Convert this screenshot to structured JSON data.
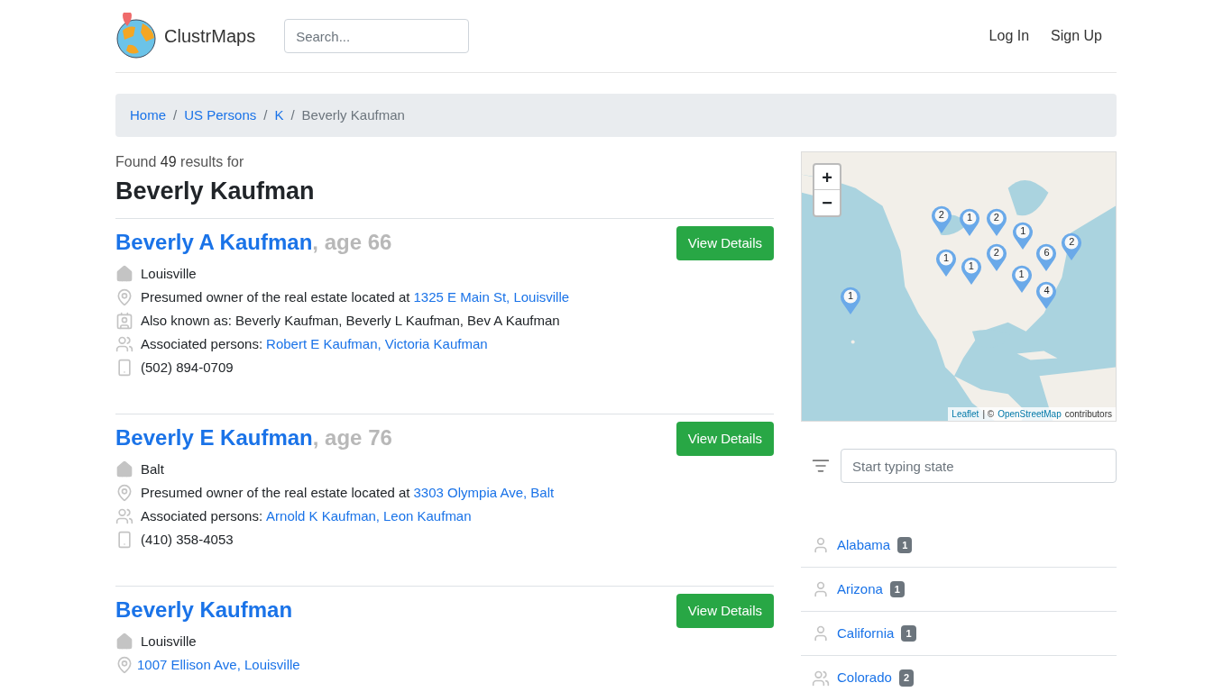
{
  "header": {
    "brand": "ClustrMaps",
    "search": {
      "placeholder": "Search..."
    },
    "nav": [
      "Log In",
      "Sign Up"
    ]
  },
  "breadcrumb": [
    {
      "label": "Home",
      "link": true
    },
    {
      "separator": "/",
      "label": "US Persons",
      "link": true
    },
    {
      "separator": "/",
      "label": "K",
      "link": true
    },
    {
      "separator": "/",
      "label": "Beverly Kaufman",
      "link": false
    }
  ],
  "results": {
    "found_prefix": "Found",
    "count": "49",
    "found_suffix": "results for",
    "query": "Beverly Kaufman"
  },
  "persons": [
    {
      "name": "Beverly A Kaufman",
      "age": ", age 66",
      "button": "View Details",
      "details": [
        {
          "kind": "home",
          "text": "Louisville"
        },
        {
          "kind": "pin",
          "text": "Presumed owner of the real estate located at",
          "links": [
            "1325 E Main St, Louisville"
          ]
        },
        {
          "kind": "aka",
          "text": "Also known as: Beverly Kaufman, Beverly L Kaufman, Bev A Kaufman"
        },
        {
          "kind": "people",
          "text": "Associated persons:",
          "links": [
            "Robert E Kaufman,",
            "Victoria Kaufman"
          ]
        },
        {
          "kind": "phone",
          "text": "(502) 894-0709"
        }
      ]
    },
    {
      "name": "Beverly E Kaufman",
      "age": ", age 76",
      "button": "View Details",
      "details": [
        {
          "kind": "home",
          "text": "Balt"
        },
        {
          "kind": "pin",
          "text": "Presumed owner of the real estate located at",
          "links": [
            "3303 Olympia Ave, Balt"
          ]
        },
        {
          "kind": "people",
          "text": "Associated persons:",
          "links": [
            "Arnold K Kaufman,",
            "Leon Kaufman"
          ]
        },
        {
          "kind": "phone",
          "text": "(410) 358-4053"
        }
      ]
    },
    {
      "name": "Beverly Kaufman",
      "button": "View Details",
      "details": [
        {
          "kind": "home",
          "text": "Louisville"
        },
        {
          "kind": "pin",
          "links": [
            "1007 Ellison Ave, Louisville"
          ]
        }
      ]
    }
  ],
  "map": {
    "zoom_in": "+",
    "zoom_out": "−",
    "markers": [
      "2",
      "1",
      "2",
      "1",
      "1",
      "2",
      "1",
      "1",
      "6",
      "4",
      "2",
      "1"
    ],
    "attribution": {
      "leaflet": "Leaflet",
      "separator": "| ©",
      "osm": "OpenStreetMap",
      "suffix": "contributors"
    }
  },
  "state_filter": {
    "placeholder": "Start typing state"
  },
  "states": [
    {
      "name": "Alabama",
      "count": "1",
      "kind": "person"
    },
    {
      "name": "Arizona",
      "count": "1",
      "kind": "person"
    },
    {
      "name": "California",
      "count": "1",
      "kind": "person"
    },
    {
      "name": "Colorado",
      "count": "2",
      "kind": "people"
    }
  ]
}
